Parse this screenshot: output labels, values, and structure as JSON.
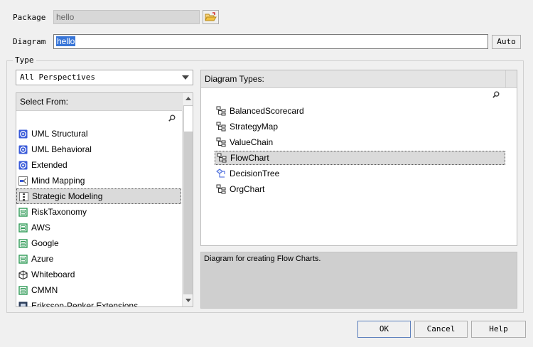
{
  "package": {
    "label": "Package",
    "value": "hello"
  },
  "diagram": {
    "label": "Diagram",
    "value": "hello",
    "auto_button": "Auto"
  },
  "type_group": {
    "legend": "Type",
    "perspective": "All Perspectives",
    "select_from": {
      "header": "Select From:",
      "items": [
        {
          "label": "UML Structural",
          "icon": "uml-icon"
        },
        {
          "label": "UML Behavioral",
          "icon": "uml-icon"
        },
        {
          "label": "Extended",
          "icon": "uml-icon"
        },
        {
          "label": "Mind Mapping",
          "icon": "mindmap-icon"
        },
        {
          "label": "Strategic Modeling",
          "icon": "strategic-icon"
        },
        {
          "label": "RiskTaxonomy",
          "icon": "green-diagram-icon"
        },
        {
          "label": "AWS",
          "icon": "green-diagram-icon"
        },
        {
          "label": "Google",
          "icon": "green-diagram-icon"
        },
        {
          "label": "Azure",
          "icon": "green-diagram-icon"
        },
        {
          "label": "Whiteboard",
          "icon": "whiteboard-icon"
        },
        {
          "label": "CMMN",
          "icon": "green-diagram-icon"
        },
        {
          "label": "Eriksson-Penker Extensions",
          "icon": "ep-icon"
        }
      ],
      "selected_index": 4
    },
    "diagram_types": {
      "header": "Diagram Types:",
      "items": [
        {
          "label": "BalancedScorecard",
          "icon": "tree-diagram-icon"
        },
        {
          "label": "StrategyMap",
          "icon": "tree-diagram-icon"
        },
        {
          "label": "ValueChain",
          "icon": "tree-diagram-icon"
        },
        {
          "label": "FlowChart",
          "icon": "tree-diagram-icon"
        },
        {
          "label": "DecisionTree",
          "icon": "decision-tree-icon"
        },
        {
          "label": "OrgChart",
          "icon": "tree-diagram-icon"
        }
      ],
      "selected_index": 3
    },
    "description": "Diagram for creating Flow Charts."
  },
  "buttons": {
    "ok": "OK",
    "cancel": "Cancel",
    "help": "Help"
  },
  "colors": {
    "selection_blue": "#3875d7",
    "folder_yellow": "#f0c040",
    "uml_blue": "#3a5bd9",
    "green_icon": "#2e9a55"
  }
}
